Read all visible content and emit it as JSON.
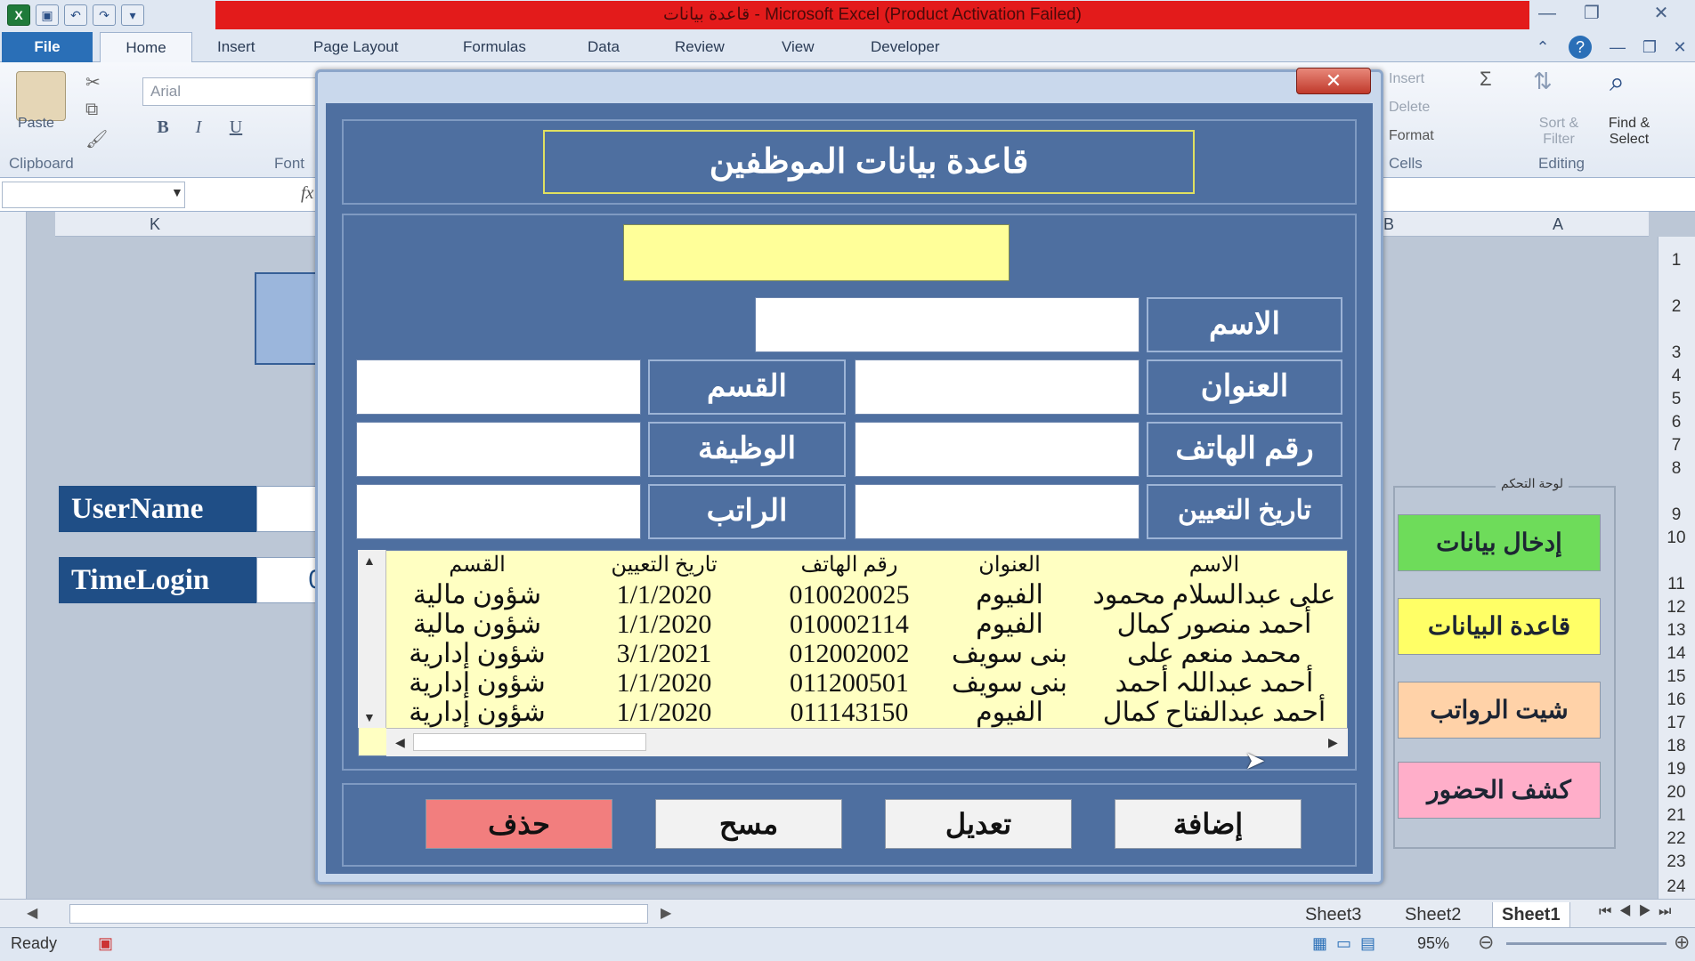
{
  "window": {
    "title": "قاعدة بيانات - Microsoft Excel (Product Activation Failed)"
  },
  "ribbon": {
    "tabs": [
      "File",
      "Home",
      "Insert",
      "Page Layout",
      "Formulas",
      "Data",
      "Review",
      "View",
      "Developer"
    ],
    "paste_label": "Paste",
    "font_name": "Arial",
    "groups": {
      "clipboard": "Clipboard",
      "font": "Font",
      "cells": "Cells",
      "editing": "Editing"
    },
    "cells_items": [
      "Insert",
      "Delete",
      "Format"
    ],
    "sort_filter": "Sort & Filter",
    "find_select": "Find & Select"
  },
  "sheet": {
    "columns": {
      "k": "K",
      "b": "B",
      "a": "A"
    },
    "rows": [
      "1",
      "2",
      "3",
      "4",
      "5",
      "6",
      "7",
      "8",
      "9",
      "10",
      "11",
      "12",
      "13",
      "14",
      "15",
      "16",
      "17",
      "18",
      "19",
      "20",
      "21",
      "22",
      "23",
      "24"
    ],
    "username_label": "UserName",
    "timelogin_label": "TimeLogin",
    "timelogin_value_partial": "0",
    "control_panel_title": "لوحة التحكم",
    "panel_buttons": [
      {
        "label": "إدخال بيانات",
        "color": "#6edc5a"
      },
      {
        "label": "قاعدة البيانات",
        "color": "#ffff66"
      },
      {
        "label": "شيت الرواتب",
        "color": "#ffd2a8"
      },
      {
        "label": "كشف الحضور",
        "color": "#ffaec9"
      }
    ],
    "sheet_tabs": [
      "Sheet3",
      "Sheet2",
      "Sheet1"
    ]
  },
  "status": {
    "ready": "Ready",
    "zoom": "95%"
  },
  "dialog": {
    "header_title": "قاعدة بيانات الموظفين",
    "labels": {
      "name": "الاسم",
      "address": "العنوان",
      "phone": "رقم الهاتف",
      "hire_date": "تاريخ التعيين",
      "department": "القسم",
      "job": "الوظيفة",
      "salary": "الراتب"
    },
    "list": {
      "headers": [
        "الاسم",
        "العنوان",
        "رقم الهاتف",
        "تاريخ التعيين",
        "القسم"
      ],
      "rows": [
        [
          "على عبدالسلام محمود",
          "الفيوم",
          "010020025",
          "1/1/2020",
          "شؤون مالية"
        ],
        [
          "أحمد منصور كمال",
          "الفيوم",
          "010002114",
          "1/1/2020",
          "شؤون مالية"
        ],
        [
          "محمد منعم على",
          "بنى سويف",
          "012002002",
          "3/1/2021",
          "شؤون إدارية"
        ],
        [
          "أحمد عبداللہ أحمد",
          "بنى سويف",
          "011200501",
          "1/1/2020",
          "شؤون إدارية"
        ],
        [
          "أحمد عبدالفتاح كمال",
          "الفيوم",
          "011143150",
          "1/1/2020",
          "شؤون إدارية"
        ]
      ]
    },
    "buttons": {
      "add": "إضافة",
      "edit": "تعديل",
      "clear": "مسح",
      "delete": "حذف"
    }
  }
}
